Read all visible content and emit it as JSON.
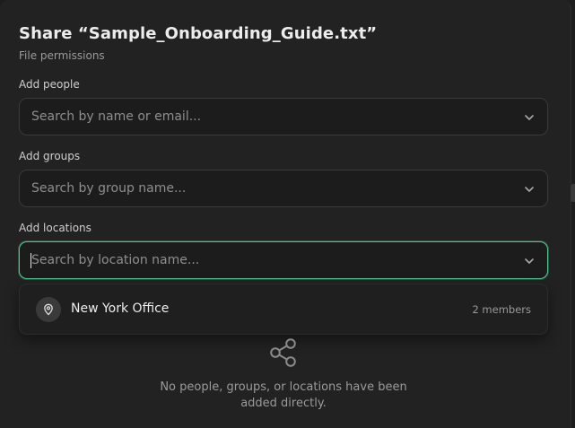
{
  "dialog": {
    "title": "Share “Sample_Onboarding_Guide.txt”",
    "subtitle": "File permissions"
  },
  "fields": {
    "people": {
      "label": "Add people",
      "placeholder": "Search by name or email...",
      "icon": "chevron-down-icon"
    },
    "groups": {
      "label": "Add groups",
      "placeholder": "Search by group name...",
      "icon": "chevron-down-icon"
    },
    "locations": {
      "label": "Add locations",
      "placeholder": "Search by location name...",
      "icon": "chevron-down-icon",
      "focused": true
    }
  },
  "location_dropdown": {
    "options": [
      {
        "name": "New York Office",
        "count": "2 members",
        "icon": "location-pin-icon"
      }
    ]
  },
  "empty_state": {
    "icon": "share-icon",
    "text": "No people, groups, or locations have been added directly."
  },
  "colors": {
    "background": "#222222",
    "focus_ring": "#4fc28b",
    "text_primary": "#ededed",
    "text_muted": "#9a9a9a"
  }
}
